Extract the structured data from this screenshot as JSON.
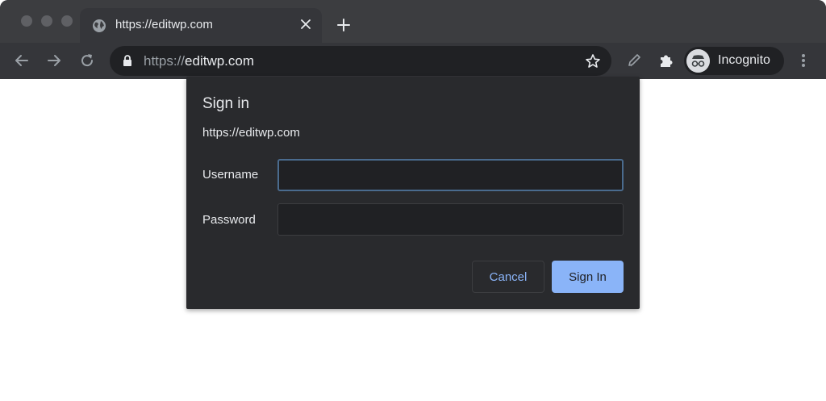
{
  "browser": {
    "tab": {
      "title": "https://editwp.com",
      "icon": "globe-icon"
    },
    "omnibox": {
      "url_scheme": "https://",
      "url_host": "editwp.com"
    },
    "profile": {
      "label": "Incognito"
    }
  },
  "dialog": {
    "title": "Sign in",
    "origin": "https://editwp.com",
    "username": {
      "label": "Username",
      "value": ""
    },
    "password": {
      "label": "Password",
      "value": ""
    },
    "cancel_label": "Cancel",
    "signin_label": "Sign In"
  },
  "colors": {
    "accent": "#8ab4f8",
    "dialog_bg": "#292a2d",
    "toolbar_bg": "#35363a",
    "tabstrip_bg": "#3c3d40",
    "focus_ring": "#4a6b8e"
  }
}
